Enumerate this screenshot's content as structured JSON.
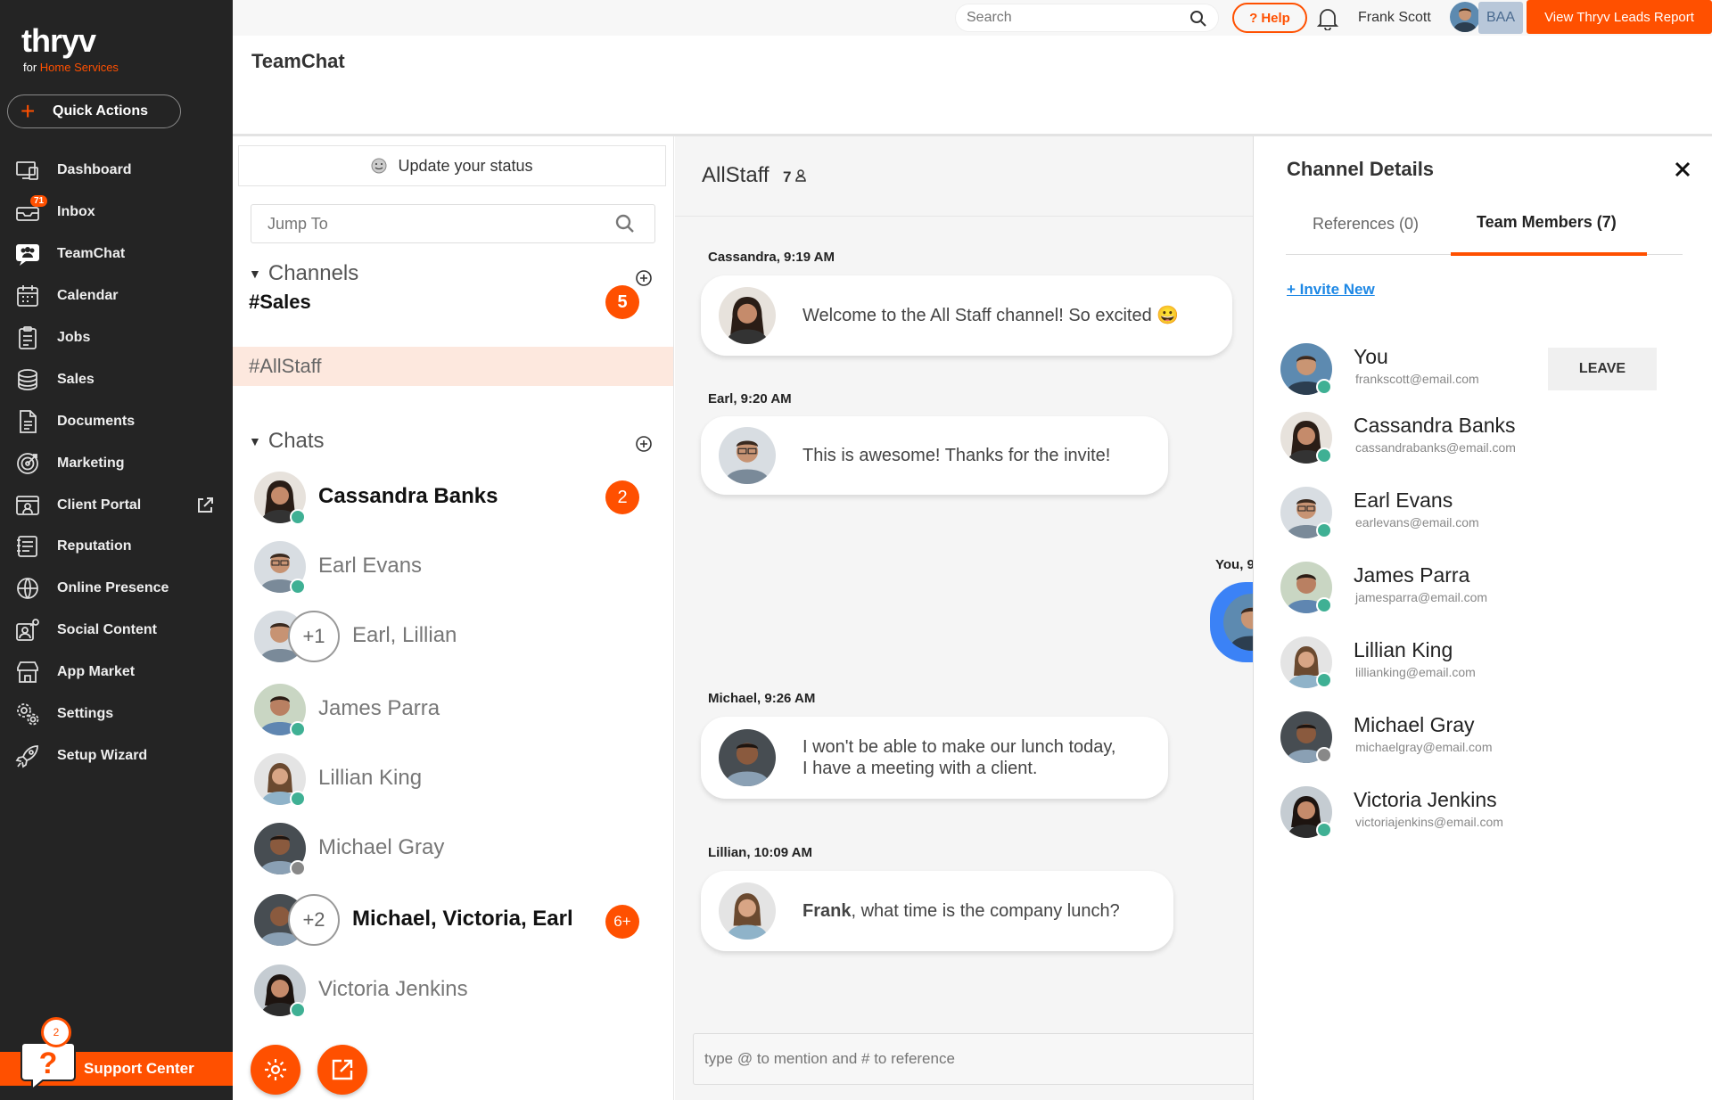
{
  "app": {
    "brand": "thryv",
    "subtitle_prefix": "for",
    "subtitle_accent": "Home Services",
    "accent_color": "#ff5000"
  },
  "sidebar": {
    "quick_actions": "Quick Actions",
    "items": [
      {
        "label": "Dashboard",
        "icon": "dashboard-icon"
      },
      {
        "label": "Inbox",
        "icon": "inbox-icon",
        "badge": "71"
      },
      {
        "label": "TeamChat",
        "icon": "teamchat-icon"
      },
      {
        "label": "Calendar",
        "icon": "calendar-icon"
      },
      {
        "label": "Jobs",
        "icon": "jobs-icon"
      },
      {
        "label": "Sales",
        "icon": "sales-icon"
      },
      {
        "label": "Documents",
        "icon": "documents-icon"
      },
      {
        "label": "Marketing",
        "icon": "marketing-icon"
      },
      {
        "label": "Client Portal",
        "icon": "client-portal-icon"
      },
      {
        "label": "Reputation",
        "icon": "reputation-icon"
      },
      {
        "label": "Online Presence",
        "icon": "globe-icon"
      },
      {
        "label": "Social Content",
        "icon": "social-content-icon"
      },
      {
        "label": "App Market",
        "icon": "store-icon"
      },
      {
        "label": "Settings",
        "icon": "gear-icon"
      },
      {
        "label": "Setup Wizard",
        "icon": "rocket-icon"
      }
    ],
    "support_label": "Support Center",
    "support_badge": "2"
  },
  "topbar": {
    "search_placeholder": "Search",
    "help_label": "Help",
    "user_name": "Frank Scott",
    "account_code": "BAA",
    "leads_button": "View Thryv Leads Report"
  },
  "page_title": "TeamChat",
  "list": {
    "status_label": "Update your status",
    "jump_placeholder": "Jump To",
    "channels_header": "Channels",
    "channels": [
      {
        "name": "#Sales",
        "unread": "5"
      },
      {
        "name": "#AllStaff"
      }
    ],
    "chats_header": "Chats",
    "chats": [
      {
        "name": "Cassandra Banks",
        "unread": "2",
        "status": "online"
      },
      {
        "name": "Earl Evans",
        "status": "online"
      },
      {
        "name": "Earl, Lillian",
        "extra": "+1"
      },
      {
        "name": "James Parra",
        "status": "online"
      },
      {
        "name": "Lillian King",
        "status": "online"
      },
      {
        "name": "Michael Gray",
        "status": "offline"
      },
      {
        "name": "Michael, Victoria, Earl",
        "extra": "+2",
        "unread": "6+"
      },
      {
        "name": "Victoria Jenkins",
        "status": "online"
      }
    ]
  },
  "conversation": {
    "title": "AllStaff",
    "member_count": "7",
    "messages": [
      {
        "meta": "Cassandra, 9:19 AM",
        "text": "Welcome to the All Staff channel! So excited 😀"
      },
      {
        "meta": "Earl, 9:20 AM",
        "text": "This is awesome! Thanks for the invite!"
      },
      {
        "meta": "Michael, 9:26 AM",
        "text": "I won't be able to make our lunch today, I have a meeting with a client."
      },
      {
        "meta": "Lillian, 10:09 AM",
        "mention": "Frank",
        "text": ", what time is the company lunch?"
      }
    ],
    "own_meta": "You, 9",
    "input_placeholder": "type @ to mention and # to reference"
  },
  "details": {
    "title": "Channel Details",
    "tab_references": "References (0)",
    "tab_members": "Team Members (7)",
    "invite_label": "+ Invite New",
    "leave_label": "LEAVE",
    "members": [
      {
        "name": "You",
        "email": "frankscott@email.com",
        "status": "online"
      },
      {
        "name": "Cassandra Banks",
        "email": "cassandrabanks@email.com",
        "status": "online"
      },
      {
        "name": "Earl Evans",
        "email": "earlevans@email.com",
        "status": "online"
      },
      {
        "name": "James Parra",
        "email": "jamesparra@email.com",
        "status": "online"
      },
      {
        "name": "Lillian King",
        "email": "lillianking@email.com",
        "status": "online"
      },
      {
        "name": "Michael Gray",
        "email": "michaelgray@email.com",
        "status": "offline"
      },
      {
        "name": "Victoria Jenkins",
        "email": "victoriajenkins@email.com",
        "status": "online"
      }
    ]
  }
}
